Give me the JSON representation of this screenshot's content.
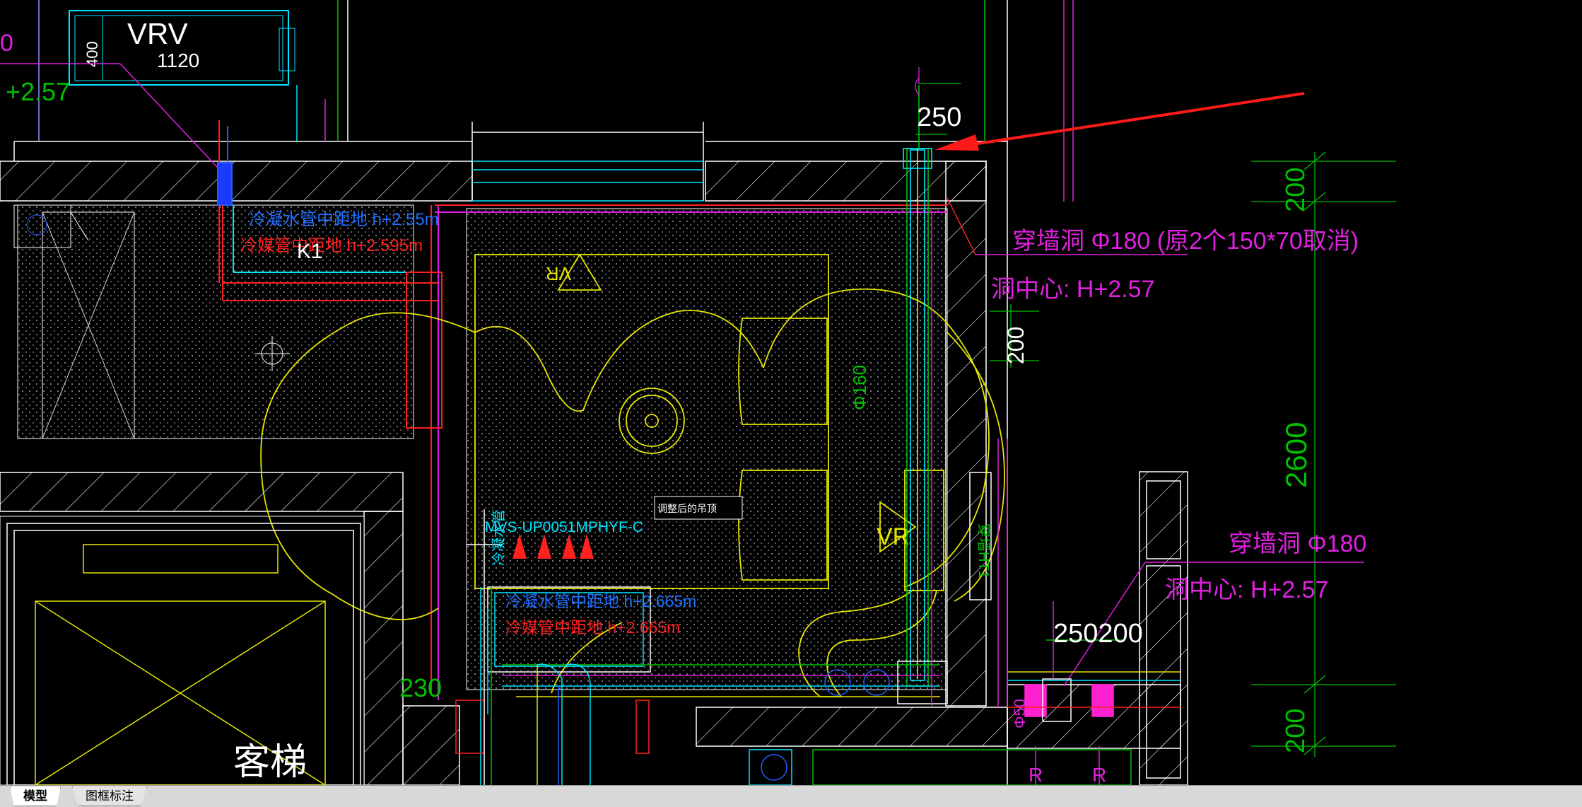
{
  "colors": {
    "background": "#000000",
    "wall": "#ffffff",
    "yellow": "#e6e600",
    "cyan": "#00e5ff",
    "green": "#00c000",
    "red": "#ff2020",
    "magenta": "#e020e0",
    "blue": "#2060ff",
    "arrow": "#ff1a1a"
  },
  "labels": {
    "vrv": "VRV",
    "vrv_size": "1120",
    "vrv_side": "400",
    "left_cut_0": "0",
    "left_elev": "+2.57",
    "dim_250": "250",
    "dim_200_top": "200",
    "dim_200_mid": "200",
    "dim_2600": "2600",
    "dim_200_bottom": "200",
    "dim_250200": "250200",
    "dim_230": "230",
    "k1": "K1",
    "hole1_line1": "穿墙洞  Φ180  (原2个150*70取消)",
    "hole1_line2": "洞中心:  H+2.57",
    "hole2_line1": "穿墙洞  Φ180",
    "hole2_line2": "洞中心:  H+2.57",
    "cond_pipe_top": "冷凝水管中距地  h+2.55m",
    "ref_pipe_top": "冷媒管中距地  h+2.595m",
    "cond_pipe_bottom": "冷凝水管中距地  h+2.665m",
    "ref_pipe_bottom": "冷媒管中距地  h+2.665m",
    "model_code": "MVS-UP0051MPHYF-C",
    "adjusted_hanger": "调整后的吊顶",
    "phi160": "Φ160",
    "phi50": "Φ50",
    "elevator": "客梯",
    "vr1": "VR",
    "vr2": "VR",
    "side_label": "穿墙HT1",
    "r_a": "R",
    "r_b": "R",
    "vert_pipe_text": "冷凝水管"
  },
  "tabs": [
    {
      "label": "模型",
      "active": true
    },
    {
      "label": "图框标注",
      "active": false
    }
  ]
}
